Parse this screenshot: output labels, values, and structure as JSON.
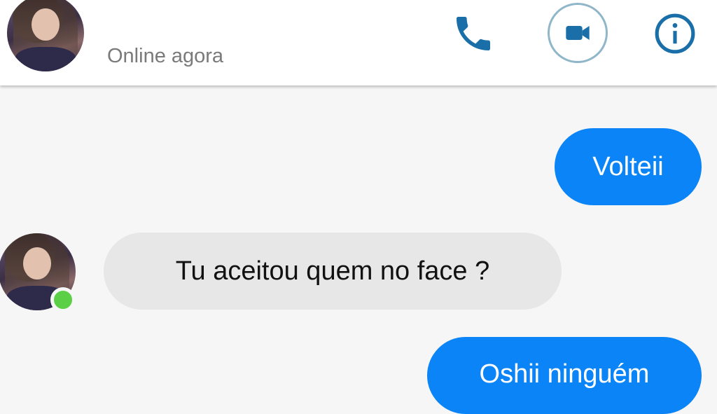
{
  "header": {
    "status": "Online agora",
    "actions": [
      {
        "name": "phone-icon"
      },
      {
        "name": "video-camera-icon"
      },
      {
        "name": "info-icon"
      }
    ]
  },
  "messages": [
    {
      "direction": "outgoing",
      "text": "Volteii"
    },
    {
      "direction": "incoming",
      "text": "Tu aceitou quem no face ?"
    },
    {
      "direction": "outgoing",
      "text": "Oshii ninguém"
    }
  ],
  "colors": {
    "accent": "#0a84f7",
    "incoming_bubble": "#e7e7e7",
    "online": "#5bcf45",
    "icon": "#1a6fa8"
  }
}
